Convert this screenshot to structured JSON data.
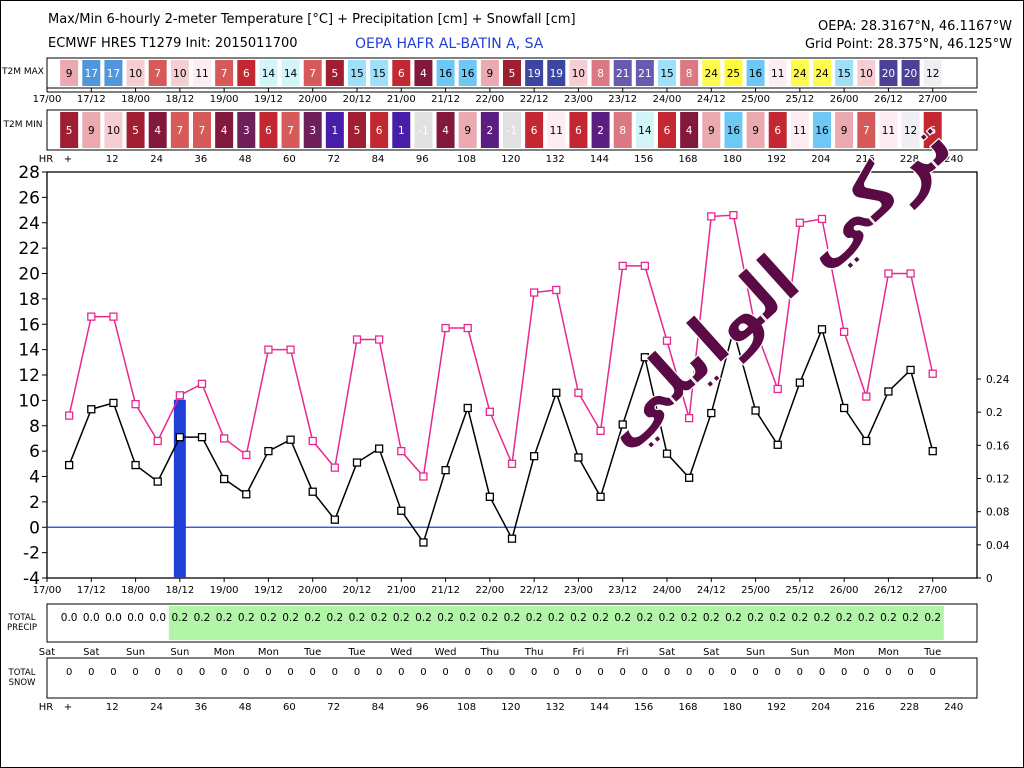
{
  "header": {
    "title": "Max/Min 6-hourly 2-meter Temperature [°C] + Precipitation [cm] + Snowfall [cm]",
    "model": "ECMWF HRES T1279 Init: 2015011700",
    "station": "OEPA HAFR AL-BATIN A, SA",
    "station_coords": "OEPA: 28.3167°N, 46.1167°W",
    "grid_point": "Grid Point: 28.375°N, 46.125°W"
  },
  "watermark": "تركي الوايلي",
  "colors": {
    "max_line": "#e8288e",
    "min_line": "#000000",
    "zero_line": "#1f3fd6",
    "precip_bar": "#1f3fd6",
    "precip_fill": "#b2f5a8"
  },
  "rows": {
    "t2m_max_label": "T2M MAX",
    "t2m_min_label": "T2M MIN",
    "total_precip_label": [
      "TOTAL",
      "PRECIP"
    ],
    "total_snow_label": [
      "TOTAL",
      "SNOW"
    ],
    "hr_label": "HR"
  },
  "time_axis": {
    "date_ticks": [
      "17/00",
      "17/12",
      "18/00",
      "18/12",
      "19/00",
      "19/12",
      "20/00",
      "20/12",
      "21/00",
      "21/12",
      "22/00",
      "22/12",
      "23/00",
      "23/12",
      "24/00",
      "24/12",
      "25/00",
      "25/12",
      "26/00",
      "26/12",
      "27/00"
    ],
    "hour_ticks": [
      "+",
      "12",
      "24",
      "36",
      "48",
      "60",
      "72",
      "84",
      "96",
      "108",
      "120",
      "132",
      "144",
      "156",
      "168",
      "180",
      "192",
      "204",
      "216",
      "228",
      "240"
    ],
    "day_names": [
      "Sat",
      "Sat",
      "Sun",
      "Sun",
      "Mon",
      "Mon",
      "Tue",
      "Tue",
      "Wed",
      "Wed",
      "Thu",
      "Thu",
      "Fri",
      "Fri",
      "Sat",
      "Sat",
      "Sun",
      "Sun",
      "Mon",
      "Mon",
      "Tue"
    ]
  },
  "chart_data": {
    "type": "line",
    "x_hours": [
      6,
      12,
      18,
      24,
      30,
      36,
      42,
      48,
      54,
      60,
      66,
      72,
      78,
      84,
      90,
      96,
      102,
      108,
      114,
      120,
      126,
      132,
      138,
      144,
      150,
      156,
      162,
      168,
      174,
      180,
      186,
      192,
      198,
      204,
      210,
      216,
      222,
      228,
      234,
      240
    ],
    "series": [
      {
        "name": "T2M MAX",
        "values": [
          9,
          17,
          17,
          10,
          7,
          10,
          11,
          7,
          6,
          14,
          14,
          7,
          5,
          15,
          15,
          6,
          4,
          16,
          16,
          9,
          5,
          19,
          19,
          10,
          8,
          21,
          21,
          15,
          8,
          24,
          25,
          16,
          11,
          24,
          24,
          15,
          10,
          20,
          20,
          12
        ]
      },
      {
        "name": "T2M MIN",
        "values": [
          5,
          9,
          10,
          5,
          4,
          7,
          7,
          4,
          3,
          6,
          7,
          3,
          1,
          5,
          6,
          1,
          -1,
          4,
          9,
          2,
          -1,
          6,
          11,
          6,
          2,
          8,
          14,
          6,
          4,
          9,
          16,
          9,
          6,
          11,
          16,
          9,
          7,
          11,
          12,
          6
        ]
      }
    ],
    "plot_max": [
      8.8,
      16.6,
      16.6,
      9.7,
      6.8,
      10.4,
      11.3,
      7.0,
      5.7,
      14.0,
      14.0,
      6.8,
      4.7,
      14.8,
      14.8,
      6.0,
      4.0,
      15.7,
      15.7,
      9.1,
      5.0,
      18.5,
      18.7,
      10.6,
      7.6,
      20.6,
      20.6,
      14.7,
      8.6,
      24.5,
      24.6,
      15.6,
      10.9,
      24.0,
      24.3,
      15.4,
      10.3,
      20.0,
      20.0,
      12.1
    ],
    "plot_min": [
      4.9,
      9.3,
      9.8,
      4.9,
      3.6,
      7.1,
      7.1,
      3.8,
      2.6,
      6.0,
      6.9,
      2.8,
      0.6,
      5.1,
      6.2,
      1.3,
      -1.2,
      4.5,
      9.4,
      2.4,
      -0.9,
      5.6,
      10.6,
      5.5,
      2.4,
      8.1,
      13.4,
      5.8,
      3.9,
      9.0,
      15.5,
      9.2,
      6.5,
      11.4,
      15.6,
      9.4,
      6.8,
      10.7,
      12.4,
      6.0
    ],
    "precip_bars": [
      {
        "hour": 36,
        "value": 0.215
      }
    ],
    "total_precip": [
      "0.0",
      "0.0",
      "0.0",
      "0.0",
      "0.0",
      "0.2",
      "0.2",
      "0.2",
      "0.2",
      "0.2",
      "0.2",
      "0.2",
      "0.2",
      "0.2",
      "0.2",
      "0.2",
      "0.2",
      "0.2",
      "0.2",
      "0.2",
      "0.2",
      "0.2",
      "0.2",
      "0.2",
      "0.2",
      "0.2",
      "0.2",
      "0.2",
      "0.2",
      "0.2",
      "0.2",
      "0.2",
      "0.2",
      "0.2",
      "0.2",
      "0.2",
      "0.2",
      "0.2",
      "0.2",
      "0.2"
    ],
    "total_snow": [
      "0",
      "0",
      "0",
      "0",
      "0",
      "0",
      "0",
      "0",
      "0",
      "0",
      "0",
      "0",
      "0",
      "0",
      "0",
      "0",
      "0",
      "0",
      "0",
      "0",
      "0",
      "0",
      "0",
      "0",
      "0",
      "0",
      "0",
      "0",
      "0",
      "0",
      "0",
      "0",
      "0",
      "0",
      "0",
      "0",
      "0",
      "0",
      "0",
      "0"
    ],
    "y_left": {
      "min": -4,
      "max": 28,
      "ticks": [
        -4,
        -2,
        0,
        2,
        4,
        6,
        8,
        10,
        12,
        14,
        16,
        18,
        20,
        22,
        24,
        26,
        28
      ]
    },
    "y_right": {
      "min": 0,
      "max": 0.24,
      "ticks": [
        "0",
        "0.04",
        "0.08",
        "0.12",
        "0.16",
        "0.2",
        "0.24"
      ]
    },
    "x_range_hours": [
      0,
      252
    ],
    "grid": false
  }
}
